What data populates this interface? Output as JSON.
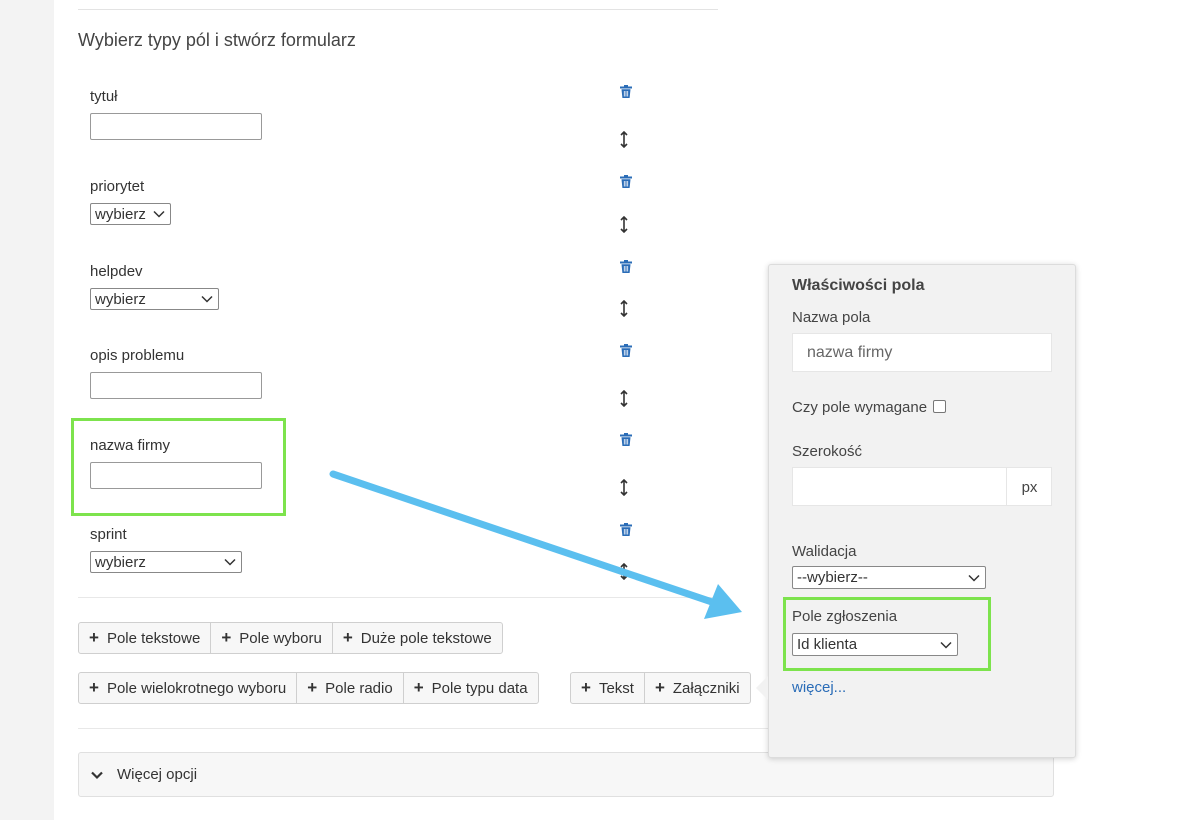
{
  "section_title": "Wybierz typy pól i stwórz formularz",
  "fields": [
    {
      "label": "tytuł",
      "type": "text"
    },
    {
      "label": "priorytet",
      "type": "select",
      "value": "wybierz"
    },
    {
      "label": "helpdev",
      "type": "select",
      "value": "wybierz"
    },
    {
      "label": "opis problemu",
      "type": "text"
    },
    {
      "label": "nazwa firmy",
      "type": "text"
    },
    {
      "label": "sprint",
      "type": "select",
      "value": "wybierz"
    }
  ],
  "buttons_row1": [
    "Pole tekstowe",
    "Pole wyboru",
    "Duże pole tekstowe"
  ],
  "buttons_row2": [
    "Pole wielokrotnego wyboru",
    "Pole radio",
    "Pole typu data"
  ],
  "buttons_row3": [
    "Tekst",
    "Załączniki"
  ],
  "more_options": "Więcej opcji",
  "popover": {
    "title": "Właściwości pola",
    "name_label": "Nazwa pola",
    "name_value": "nazwa firmy",
    "required_label": "Czy pole wymagane",
    "width_label": "Szerokość",
    "width_unit": "px",
    "validation_label": "Walidacja",
    "validation_value": "--wybierz--",
    "ticket_field_label": "Pole zgłoszenia",
    "ticket_field_value": "Id klienta",
    "more_link": "więcej..."
  },
  "colors": {
    "highlight": "#7de34d",
    "arrow": "#5bbfef",
    "link": "#2a6cb7",
    "trash": "#2a6cb7"
  }
}
